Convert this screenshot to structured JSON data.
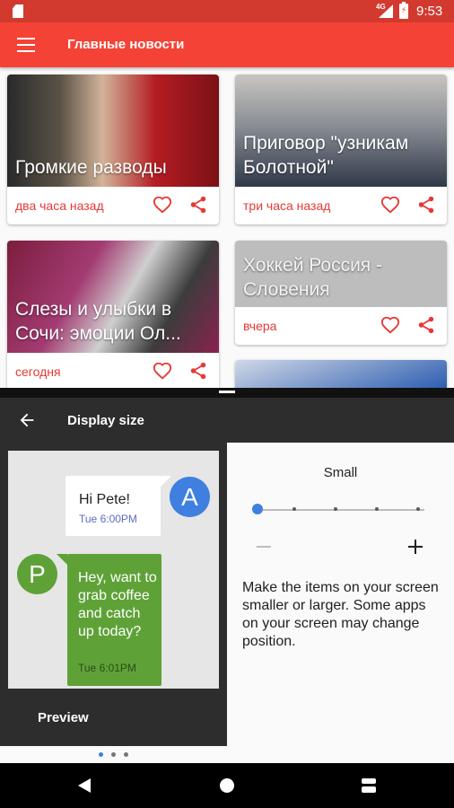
{
  "status_bar": {
    "network": "4G",
    "time": "9:53"
  },
  "app_bar": {
    "title": "Главные новости",
    "menu_icon": "hamburger-menu-icon"
  },
  "news": [
    {
      "title": "Громкие разводы",
      "time": "два часа назад"
    },
    {
      "title": "Приговор \"узникам Болотной\"",
      "time": "три часа назад"
    },
    {
      "title": "Слезы и улыбки в Сочи: эмоции Ол...",
      "time": "сегодня"
    },
    {
      "title": "Хоккей Россия - Словения",
      "time": "вчера"
    },
    {
      "title": "",
      "time": ""
    }
  ],
  "card_icons": {
    "like": "heart-outline-icon",
    "share": "share-icon"
  },
  "settings": {
    "title": "Display size",
    "back_icon": "arrow-back-icon",
    "preview": {
      "label": "Preview",
      "incoming": {
        "text": "Hi Pete!",
        "time": "Tue 6:00PM",
        "avatar": "A"
      },
      "outgoing": {
        "text": "Hey, want to grab coffee and catch up today?",
        "time": "Tue 6:01PM",
        "avatar": "P"
      }
    },
    "size": {
      "current": "Small",
      "levels": 5,
      "selected_index": 0,
      "description": "Make the items on your screen smaller or larger. Some apps on your screen may change position."
    },
    "pager": {
      "count": 3,
      "active": 0
    }
  },
  "colors": {
    "primary": "#f44336",
    "primary_dark": "#d23a2f",
    "accent": "#3f7fe0",
    "bubble_green": "#5ea237"
  }
}
